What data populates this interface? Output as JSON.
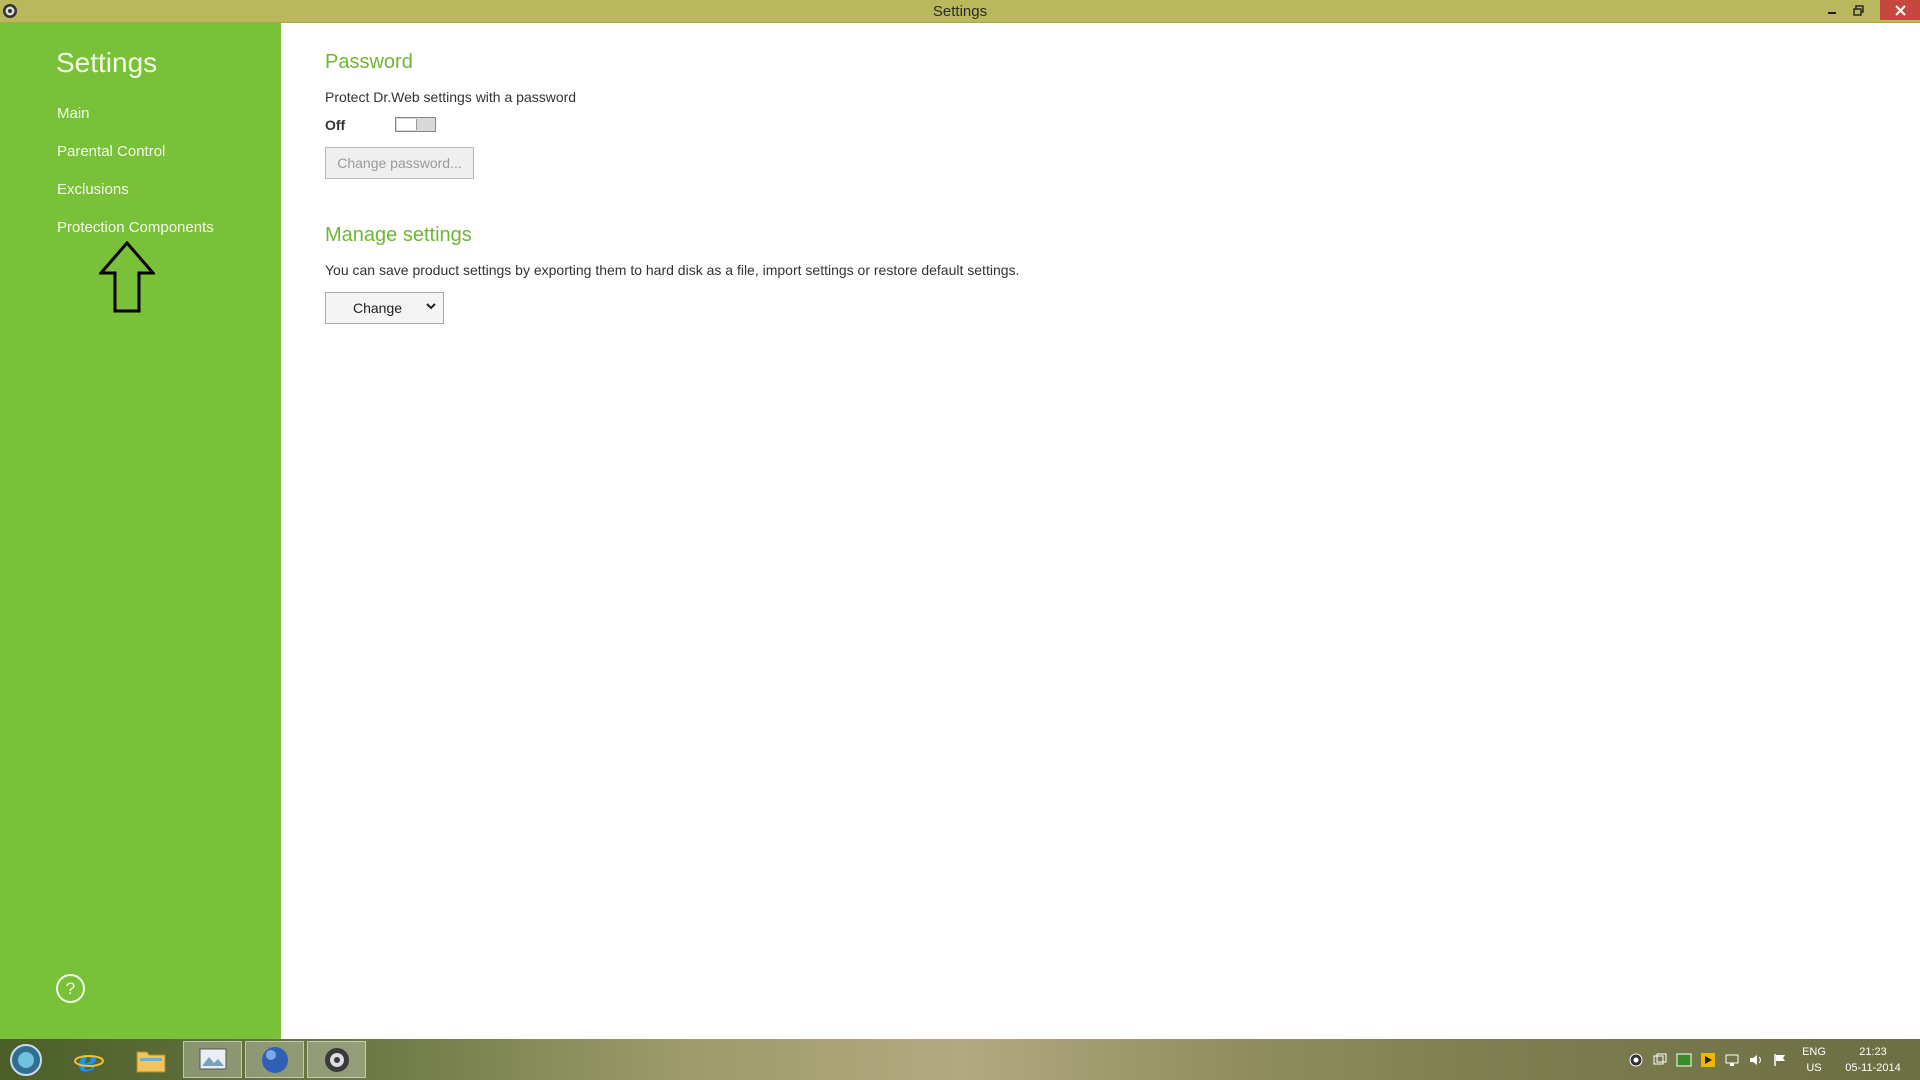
{
  "window": {
    "title": "Settings"
  },
  "sidebar": {
    "heading": "Settings",
    "items": [
      {
        "label": "Main"
      },
      {
        "label": "Parental Control"
      },
      {
        "label": "Exclusions"
      },
      {
        "label": "Protection Components"
      }
    ],
    "help_glyph": "?"
  },
  "password": {
    "title": "Password",
    "description": "Protect Dr.Web settings with a password",
    "toggle_state": "Off",
    "change_button": "Change password..."
  },
  "manage": {
    "title": "Manage settings",
    "description": "You can save product settings by exporting them to hard disk as a file, import settings or restore default settings.",
    "dropdown_value": "Change"
  },
  "taskbar": {
    "language": "ENG",
    "region": "US",
    "time": "21:23",
    "date": "05-11-2014"
  },
  "colors": {
    "sidebar": "#7ac13a",
    "accent": "#6fb632",
    "titlebar": "#b9b85c"
  }
}
